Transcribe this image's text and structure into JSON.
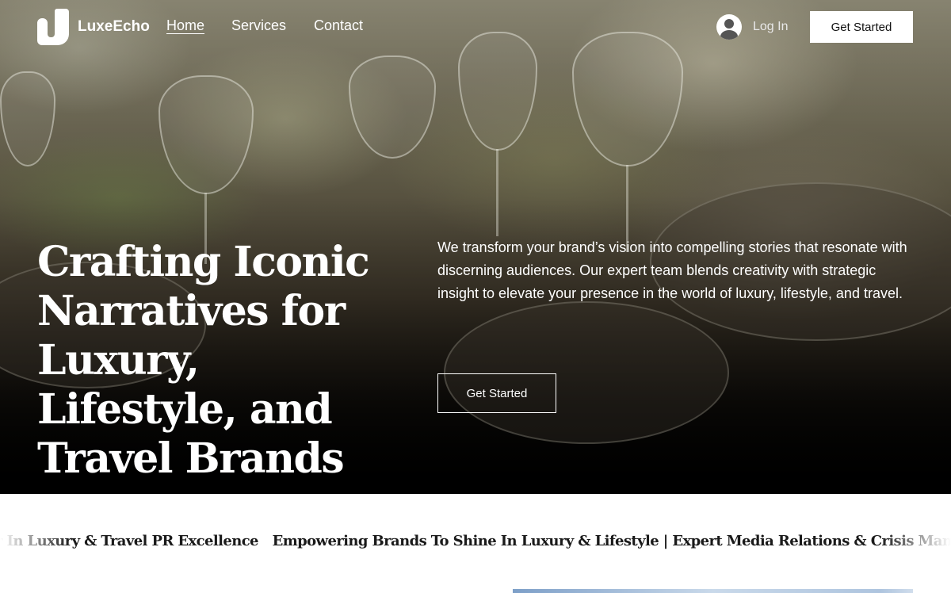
{
  "brand": {
    "name": "LuxeEcho"
  },
  "nav": {
    "links": [
      {
        "label": "Home",
        "active": true
      },
      {
        "label": "Services",
        "active": false
      },
      {
        "label": "Contact",
        "active": false
      }
    ],
    "login_label": "Log In",
    "cta_label": "Get Started"
  },
  "hero": {
    "headline": "Crafting Iconic Narratives for Luxury, Lifestyle, and Travel Brands",
    "description": "We transform your brand’s vision into compelling stories that resonate with discerning audiences. Our expert team blends creativity with strategic insight to elevate your presence in the world of luxury, lifestyle, and travel.",
    "cta_label": "Get Started"
  },
  "marquee": {
    "items": [
      "r In Luxury & Travel PR Excellence",
      "Empowering Brands To Shine In Luxury & Lifestyle | Expert Media Relations & Crisis Management | Bespoke Con"
    ]
  },
  "icons": [
    "logo-icon",
    "user-avatar-icon"
  ],
  "colors": {
    "accent": "#ffffff",
    "hero_overlay": "#000000",
    "text_dark": "#1a1a1a"
  }
}
